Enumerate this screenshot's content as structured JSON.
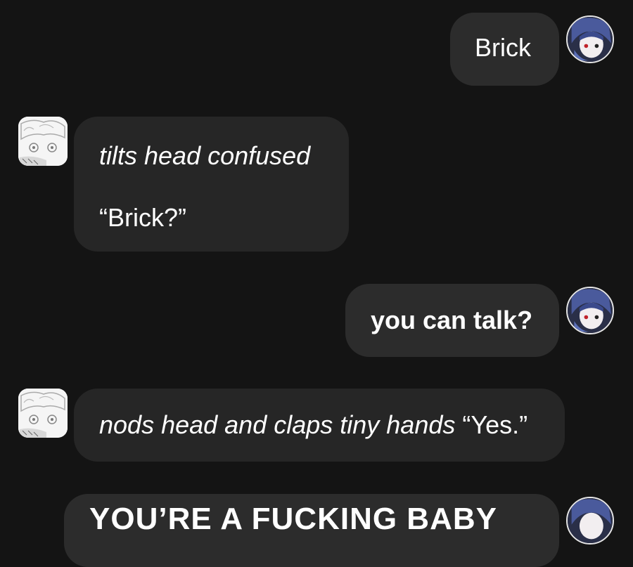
{
  "messages": [
    {
      "role": "user",
      "text": "Brick"
    },
    {
      "role": "character",
      "action": "tilts head confused",
      "speech": "“Brick?”"
    },
    {
      "role": "user",
      "text": "you can talk?"
    },
    {
      "role": "character",
      "action": "nods head and claps tiny hands",
      "speech": "“Yes.”"
    },
    {
      "role": "user",
      "text": "YOU’RE A FUCKING BABY"
    }
  ],
  "avatars": {
    "user": "user-avatar-anime-blue-hair",
    "character": "character-avatar-anime-sketch"
  },
  "colors": {
    "background": "#141414",
    "bubble": "#262626",
    "user_bubble": "#2c2c2c",
    "text": "#ffffff"
  }
}
